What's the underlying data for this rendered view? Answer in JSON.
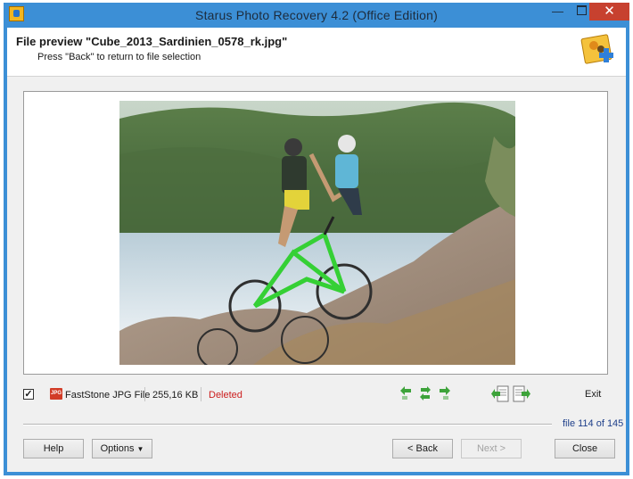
{
  "window": {
    "title": "Starus Photo Recovery 4.2 (Office Edition)",
    "minimize_glyph": "—",
    "close_glyph": "✕"
  },
  "header": {
    "title": "File preview \"Cube_2013_Sardinien_0578_rk.jpg\"",
    "subtitle": "Press \"Back\" to return to file selection"
  },
  "status": {
    "checked": "✓",
    "file_type_badge": "JPG",
    "file_type": "FastStone JPG File",
    "file_size": "255,16 KB",
    "state": "Deleted",
    "exit_label": "Exit",
    "counter": "file 114 of 145"
  },
  "buttons": {
    "help": "Help",
    "options": "Options",
    "options_caret": "▼",
    "back": "< Back",
    "next": "Next >",
    "close": "Close"
  },
  "icons": {
    "rotate_left": "rotate-left-icon",
    "flip": "flip-icon",
    "rotate_right": "rotate-right-icon",
    "prev_file": "previous-file-icon",
    "next_file": "next-file-icon"
  },
  "colors": {
    "titlebar": "#3c8fd6",
    "close": "#c7412f",
    "deleted": "#cc1e1e",
    "counter": "#1e3f8a",
    "nav_green": "#3da33a"
  }
}
